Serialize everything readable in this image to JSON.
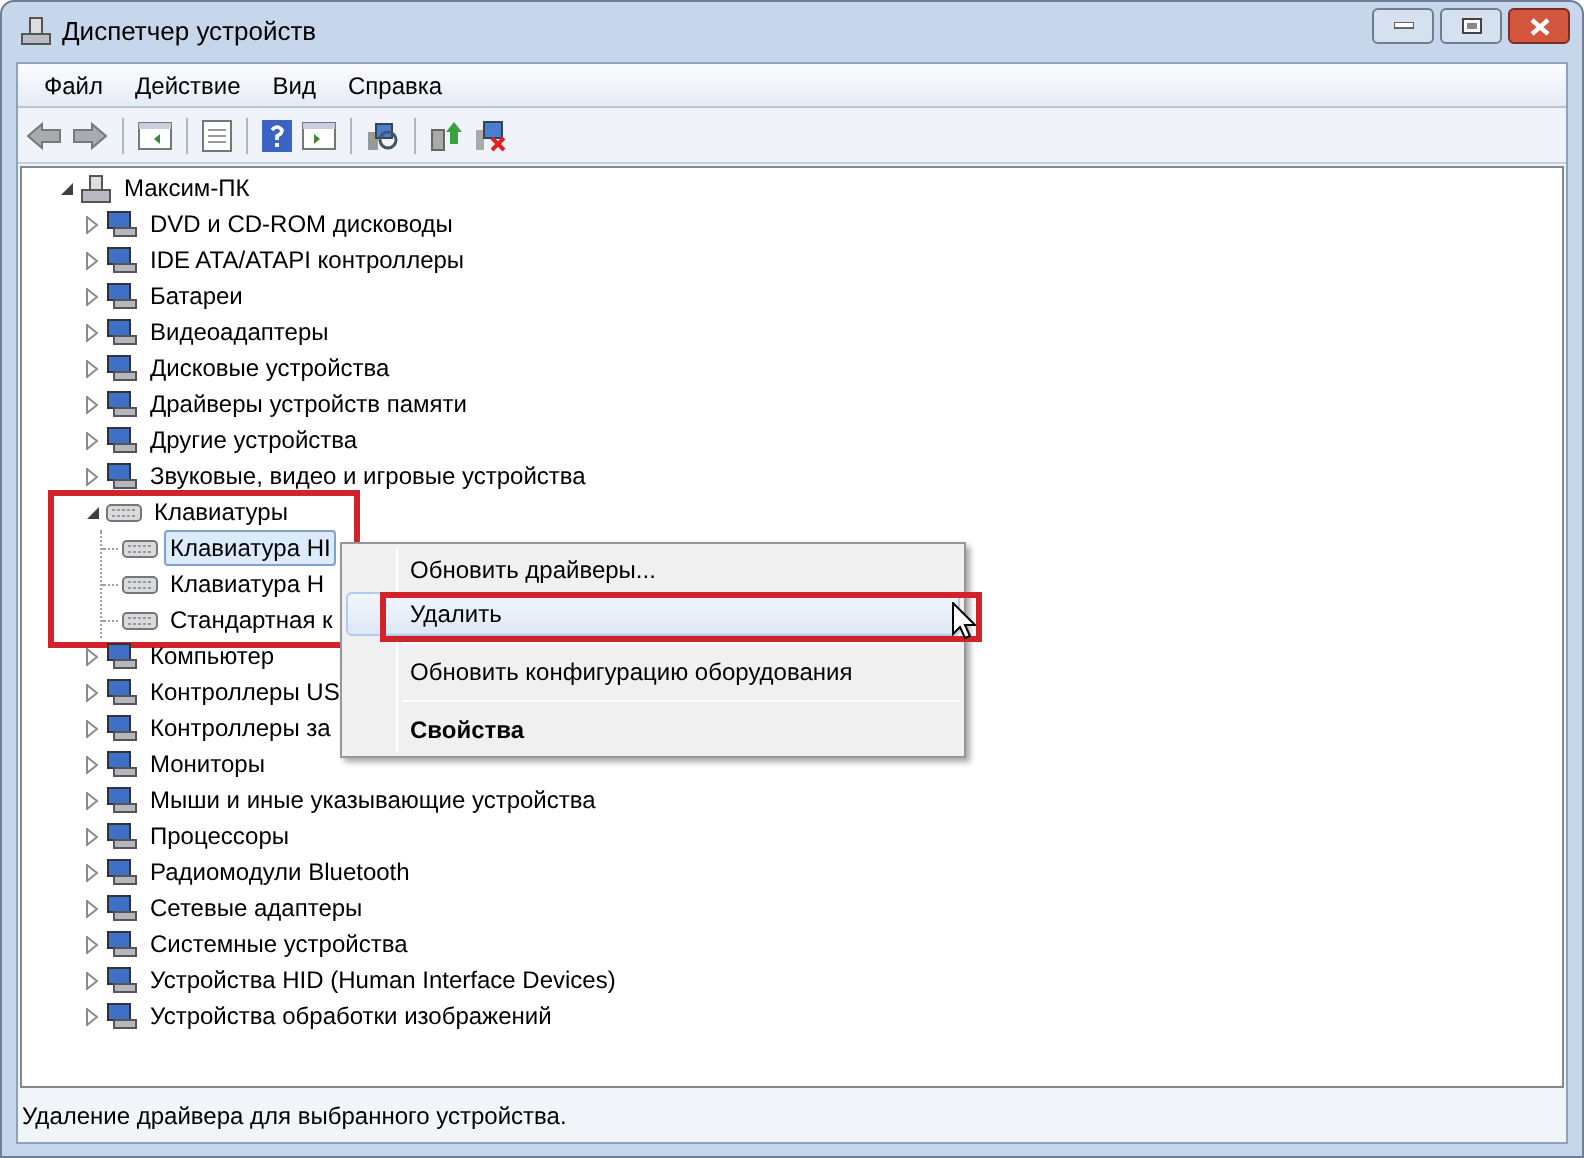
{
  "window": {
    "title": "Диспетчер устройств"
  },
  "menu_bar": [
    "Файл",
    "Действие",
    "Вид",
    "Справка"
  ],
  "tree": {
    "root": {
      "label": "Максим-ПК",
      "expanded": true,
      "children": [
        {
          "label": "DVD и CD-ROM дисководы",
          "expanded": false,
          "selected": false
        },
        {
          "label": "IDE ATA/ATAPI контроллеры",
          "expanded": false,
          "selected": false
        },
        {
          "label": "Батареи",
          "expanded": false,
          "selected": false
        },
        {
          "label": "Видеоадаптеры",
          "expanded": false,
          "selected": false
        },
        {
          "label": "Дисковые устройства",
          "expanded": false,
          "selected": false
        },
        {
          "label": "Драйверы устройств памяти",
          "expanded": false,
          "selected": false
        },
        {
          "label": "Другие устройства",
          "expanded": false,
          "selected": false
        },
        {
          "label": "Звуковые, видео и игровые устройства",
          "expanded": false,
          "selected": false
        },
        {
          "label": "Клавиатуры",
          "expanded": true,
          "selected": false,
          "annotated": true,
          "children": [
            {
              "label": "Клавиатура HI",
              "selected": true
            },
            {
              "label": "Клавиатура H",
              "selected": false
            },
            {
              "label": "Стандартная к",
              "selected": false
            }
          ]
        },
        {
          "label": "Компьютер",
          "expanded": false,
          "selected": false
        },
        {
          "label": "Контроллеры US",
          "expanded": false,
          "selected": false
        },
        {
          "label": "Контроллеры за",
          "expanded": false,
          "selected": false
        },
        {
          "label": "Мониторы",
          "expanded": false,
          "selected": false
        },
        {
          "label": "Мыши и иные указывающие устройства",
          "expanded": false,
          "selected": false
        },
        {
          "label": "Процессоры",
          "expanded": false,
          "selected": false
        },
        {
          "label": "Радиомодули Bluetooth",
          "expanded": false,
          "selected": false
        },
        {
          "label": "Сетевые адаптеры",
          "expanded": false,
          "selected": false
        },
        {
          "label": "Системные устройства",
          "expanded": false,
          "selected": false
        },
        {
          "label": "Устройства HID (Human Interface Devices)",
          "expanded": false,
          "selected": false
        },
        {
          "label": "Устройства обработки изображений",
          "expanded": false,
          "selected": false
        }
      ]
    }
  },
  "context_menu": {
    "items": [
      {
        "kind": "item",
        "label": "Обновить драйверы...",
        "selected": false
      },
      {
        "kind": "item",
        "label": "Удалить",
        "selected": true,
        "annotated": true
      },
      {
        "kind": "separator"
      },
      {
        "kind": "item",
        "label": "Обновить конфигурацию оборудования",
        "selected": false
      },
      {
        "kind": "separator"
      },
      {
        "kind": "default",
        "label": "Свойства",
        "selected": false
      }
    ]
  },
  "status_bar": "Удаление драйвера для выбранного устройства."
}
